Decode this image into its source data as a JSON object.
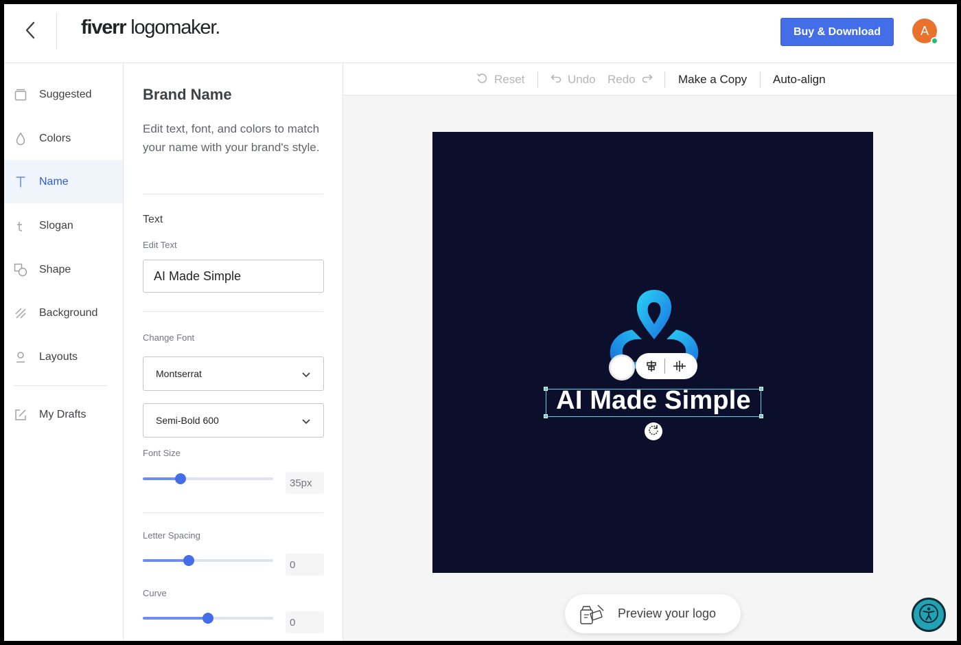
{
  "header": {
    "back_icon": "chevron-left-icon",
    "brand_part1": "fiverr",
    "brand_part2": " logo",
    "brand_part3": "maker.",
    "buy_label": "Buy & Download",
    "avatar_initial": "A",
    "colors": {
      "accent": "#446ee7",
      "avatar": "#e8722c",
      "online": "#1dbf73"
    }
  },
  "sidebar": {
    "items": [
      {
        "label": "Suggested",
        "icon": "suggested-icon"
      },
      {
        "label": "Colors",
        "icon": "droplet-icon"
      },
      {
        "label": "Name",
        "icon": "text-t-icon",
        "active": true
      },
      {
        "label": "Slogan",
        "icon": "slogan-t-icon"
      },
      {
        "label": "Shape",
        "icon": "shape-icon"
      },
      {
        "label": "Background",
        "icon": "background-icon"
      },
      {
        "label": "Layouts",
        "icon": "layouts-icon"
      },
      {
        "label": "My Drafts",
        "icon": "edit-icon"
      }
    ]
  },
  "panel": {
    "title": "Brand Name",
    "description": "Edit text, font, and colors to match your name with your brand's style.",
    "text_section": "Text",
    "edit_text_label": "Edit Text",
    "edit_text_value": "AI Made Simple",
    "change_font_label": "Change Font",
    "font_family": "Montserrat",
    "font_weight": "Semi-Bold 600",
    "font_size_label": "Font Size",
    "font_size_value": "35px",
    "font_size_fraction": 0.29,
    "letter_spacing_label": "Letter Spacing",
    "letter_spacing_value": "0",
    "letter_spacing_fraction": 0.35,
    "curve_label": "Curve",
    "curve_value": "0",
    "curve_fraction": 0.5
  },
  "toolbar": {
    "reset": "Reset",
    "undo": "Undo",
    "redo": "Redo",
    "make_copy": "Make a Copy",
    "auto_align": "Auto-align"
  },
  "canvas": {
    "logo_text": "AI Made Simple",
    "background_color": "#0b0f2b",
    "mark_colors": [
      "#1fc8f0",
      "#1a7fe0"
    ],
    "preview_label": "Preview your logo"
  }
}
